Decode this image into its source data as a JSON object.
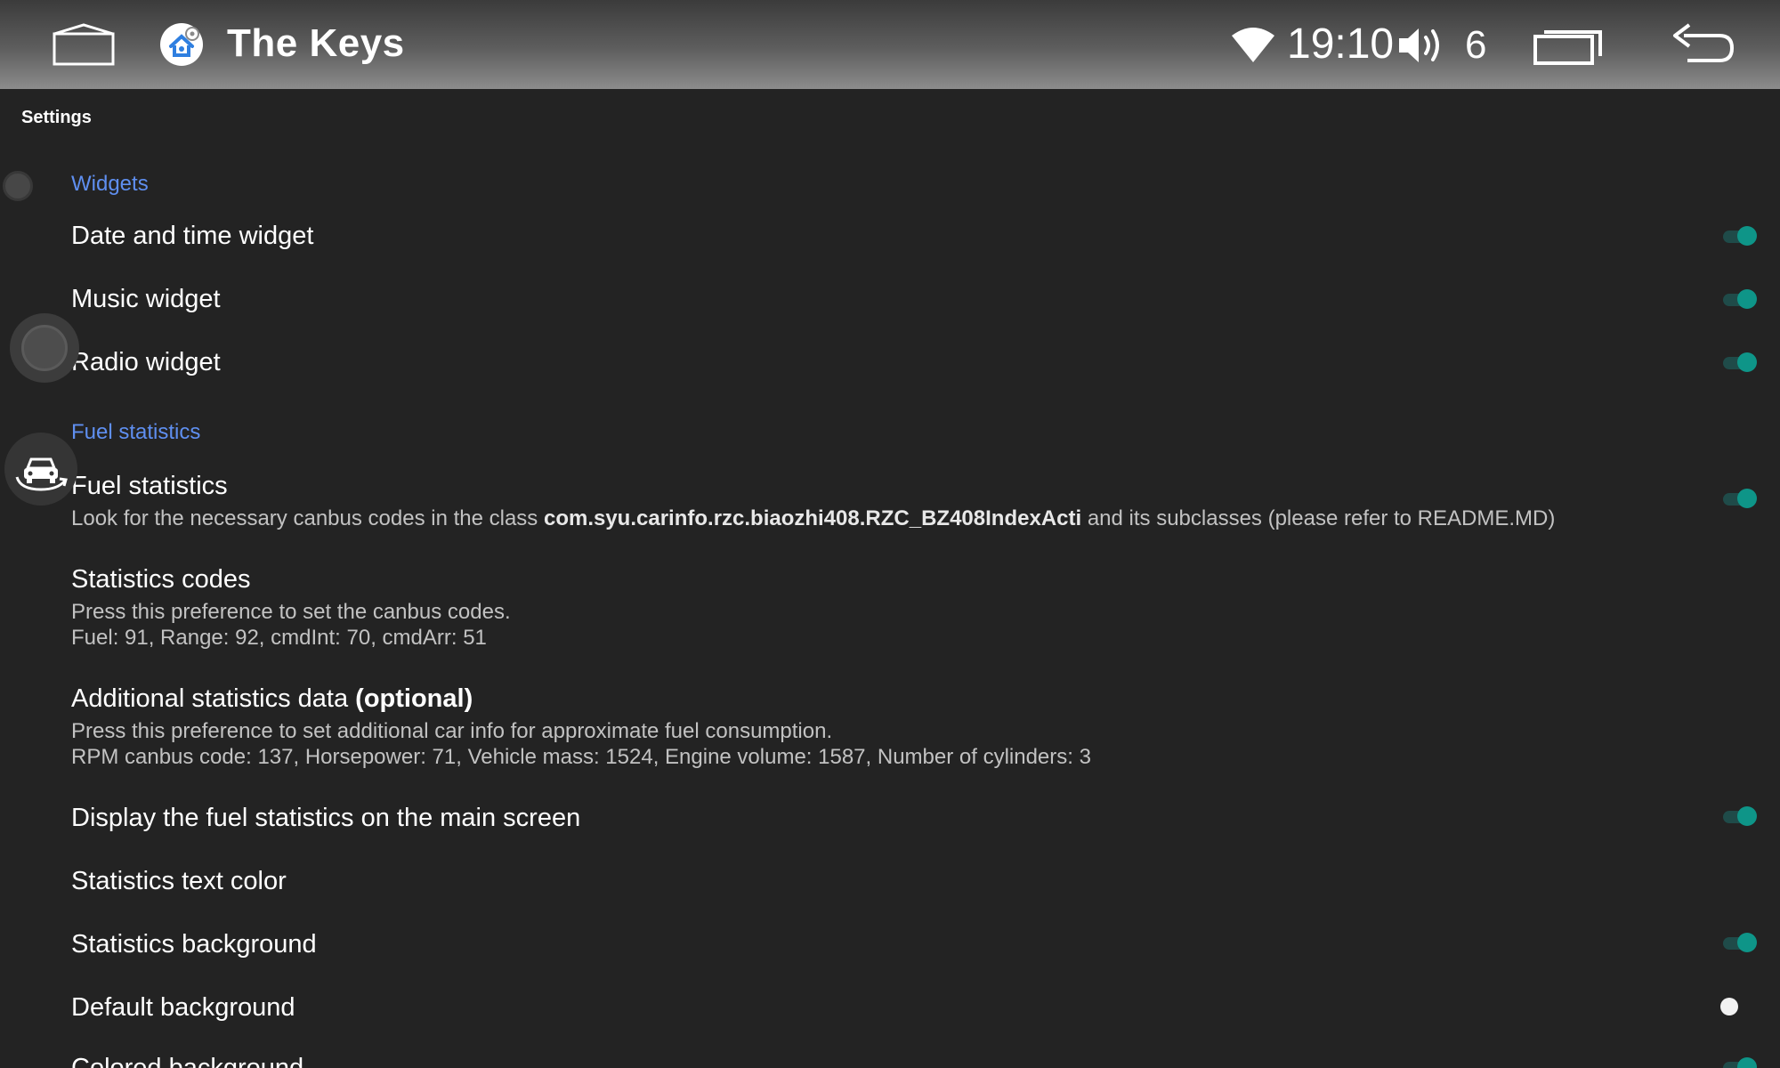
{
  "statusbar": {
    "app_title": "The Keys",
    "time": "19:10",
    "volume_level": "6",
    "icons": [
      "home-icon",
      "app-settings-icon",
      "wifi-icon",
      "volume-icon",
      "recent-apps-icon",
      "back-icon"
    ]
  },
  "screen": {
    "title": "Settings"
  },
  "categories": {
    "widgets": "Widgets",
    "fuel": "Fuel statistics"
  },
  "prefs": {
    "date_time": {
      "title": "Date and time widget",
      "enabled": true
    },
    "music": {
      "title": "Music widget",
      "enabled": true
    },
    "radio": {
      "title": "Radio widget",
      "enabled": true
    },
    "fuel_stats": {
      "title": "Fuel statistics",
      "summary_pre": "Look for the necessary canbus codes in the class ",
      "summary_class": "com.syu.carinfo.rzc.biaozhi408.RZC_BZ408IndexActi",
      "summary_post": " and its subclasses (please refer to README.MD)",
      "enabled": true
    },
    "stat_codes": {
      "title": "Statistics codes",
      "line1": "Press this preference to set the canbus codes.",
      "line2": "Fuel: 91, Range: 92, cmdInt: 70, cmdArr: 51"
    },
    "additional": {
      "title": "Additional statistics data ",
      "title_bold": "(optional)",
      "line1": "Press this preference to set additional car info for approximate fuel consumption.",
      "line2": "RPM canbus code: 137, Horsepower: 71, Vehicle mass: 1524, Engine volume: 1587, Number of cylinders: 3"
    },
    "display_main": {
      "title": "Display the fuel statistics on the main screen",
      "enabled": true
    },
    "text_color": {
      "title": "Statistics text color"
    },
    "background": {
      "title": "Statistics background",
      "enabled": true
    },
    "default_bg": {
      "title": "Default background",
      "selected": true
    },
    "colored_bg": {
      "title": "Colored background",
      "enabled": true
    }
  },
  "colors": {
    "accent": "#0e9588",
    "category": "#5f8ff0",
    "background": "#232323"
  }
}
